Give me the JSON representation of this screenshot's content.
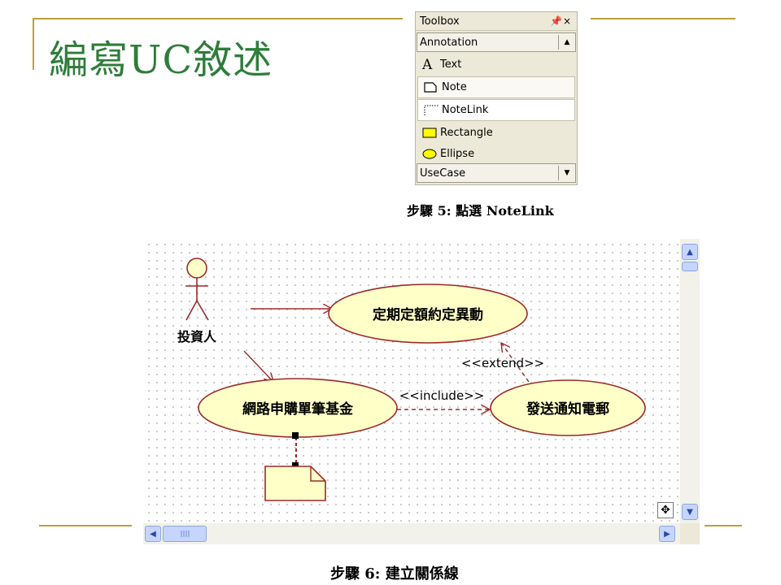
{
  "slide": {
    "title": "編寫UC敘述"
  },
  "toolbox": {
    "title": "Toolbox",
    "pin_glyph": "⊥",
    "close_glyph": "×",
    "category_annotation": "Annotation",
    "category_usecase": "UseCase",
    "items": [
      {
        "label": "Text",
        "icon": "text-icon"
      },
      {
        "label": "Note",
        "icon": "note-icon"
      },
      {
        "label": "NoteLink",
        "icon": "notelink-icon"
      },
      {
        "label": "Rectangle",
        "icon": "rectangle-icon"
      },
      {
        "label": "Ellipse",
        "icon": "ellipse-icon"
      }
    ]
  },
  "captions": {
    "step5": "步驟 5:   點選 NoteLink",
    "step6": "步驟 6:   建立關係線"
  },
  "diagram": {
    "actor": "投資人",
    "usecase_top": "定期定額約定異動",
    "usecase_left": "網路申購單筆基金",
    "usecase_right": "發送通知電郵",
    "include_label": "<<include>>",
    "extend_label": "<<extend>>"
  },
  "colors": {
    "title": "#2e7d3a",
    "rule": "#b8a23a",
    "usecase_fill": "#ffffc8",
    "usecase_stroke": "#9b2a2a",
    "note_fill": "#ffffc8"
  }
}
